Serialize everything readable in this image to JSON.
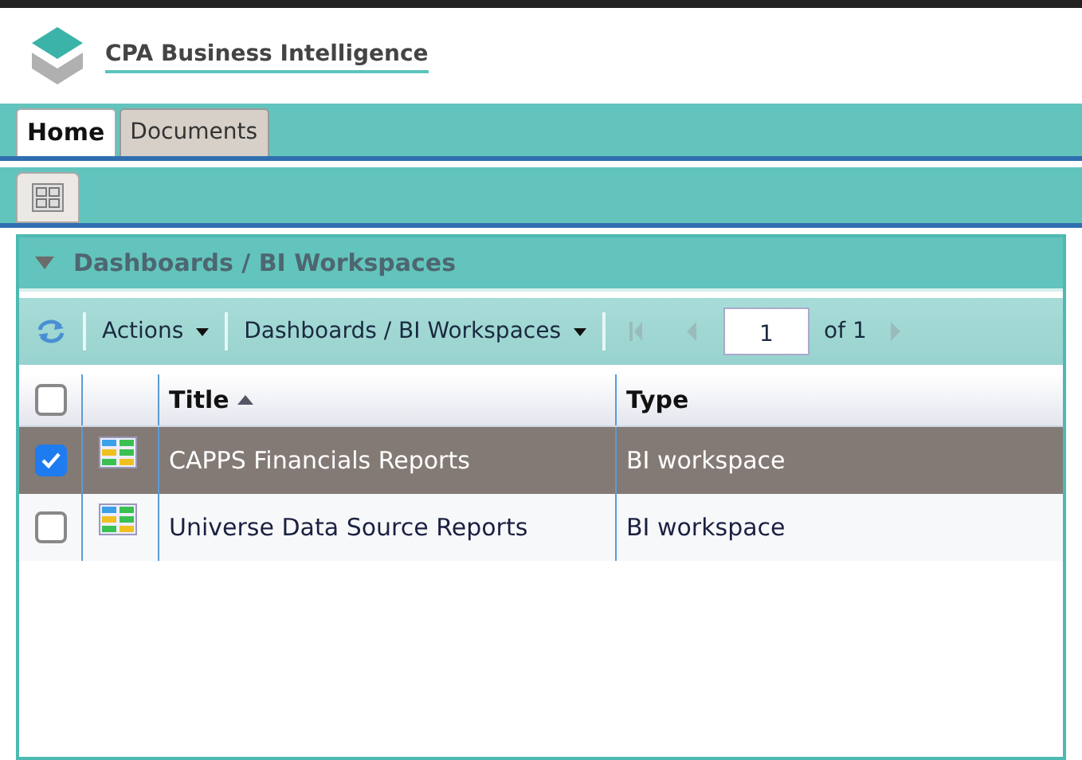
{
  "header": {
    "title": "CPA Business Intelligence"
  },
  "tabs": [
    {
      "label": "Home",
      "selected": true
    },
    {
      "label": "Documents",
      "selected": false
    }
  ],
  "panel": {
    "title": "Dashboards / BI Workspaces",
    "expanded": true
  },
  "toolbar": {
    "actions": "Actions",
    "folder": "Dashboards / BI Workspaces",
    "page": "1",
    "page_count": "of 1"
  },
  "table": {
    "select_all": {
      "checked": false
    },
    "columns": [
      {
        "label": "Title",
        "sorted": true
      },
      {
        "label": "Type",
        "sorted": false
      }
    ],
    "rows": [
      {
        "title": "CAPPS Financials Reports",
        "type": "BI workspace",
        "selected": true,
        "checked": true
      },
      {
        "title": "Universe Data Source Reports",
        "type": "BI workspace",
        "selected": false,
        "checked": false
      }
    ]
  }
}
